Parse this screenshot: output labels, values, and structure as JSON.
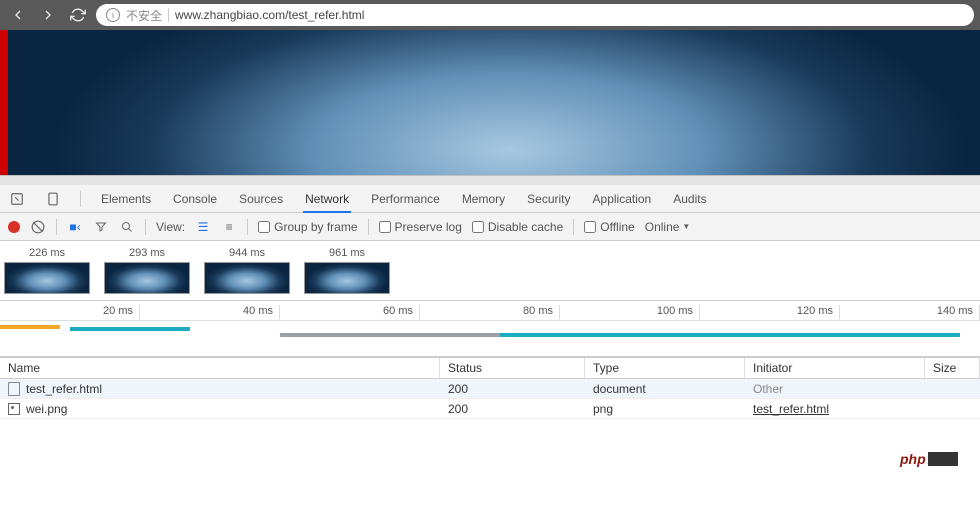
{
  "browser": {
    "insecure_label": "不安全",
    "url": "www.zhangbiao.com/test_refer.html"
  },
  "devtools": {
    "tabs": [
      "Elements",
      "Console",
      "Sources",
      "Network",
      "Performance",
      "Memory",
      "Security",
      "Application",
      "Audits"
    ],
    "active_tab": "Network",
    "toolbar": {
      "view_label": "View:",
      "group_by_frame": "Group by frame",
      "preserve_log": "Preserve log",
      "disable_cache": "Disable cache",
      "offline": "Offline",
      "throttle": "Online"
    },
    "filmstrip": [
      "226 ms",
      "293 ms",
      "944 ms",
      "961 ms"
    ],
    "overview_ticks": [
      "20 ms",
      "40 ms",
      "60 ms",
      "80 ms",
      "100 ms",
      "120 ms",
      "140 ms"
    ],
    "columns": {
      "name": "Name",
      "status": "Status",
      "type": "Type",
      "initiator": "Initiator",
      "size": "Size"
    },
    "rows": [
      {
        "name": "test_refer.html",
        "status": "200",
        "type": "document",
        "initiator": "Other",
        "icon": "file",
        "initiator_link": false
      },
      {
        "name": "wei.png",
        "status": "200",
        "type": "png",
        "initiator": "test_refer.html",
        "icon": "image",
        "initiator_link": true
      }
    ]
  },
  "watermark": "php"
}
